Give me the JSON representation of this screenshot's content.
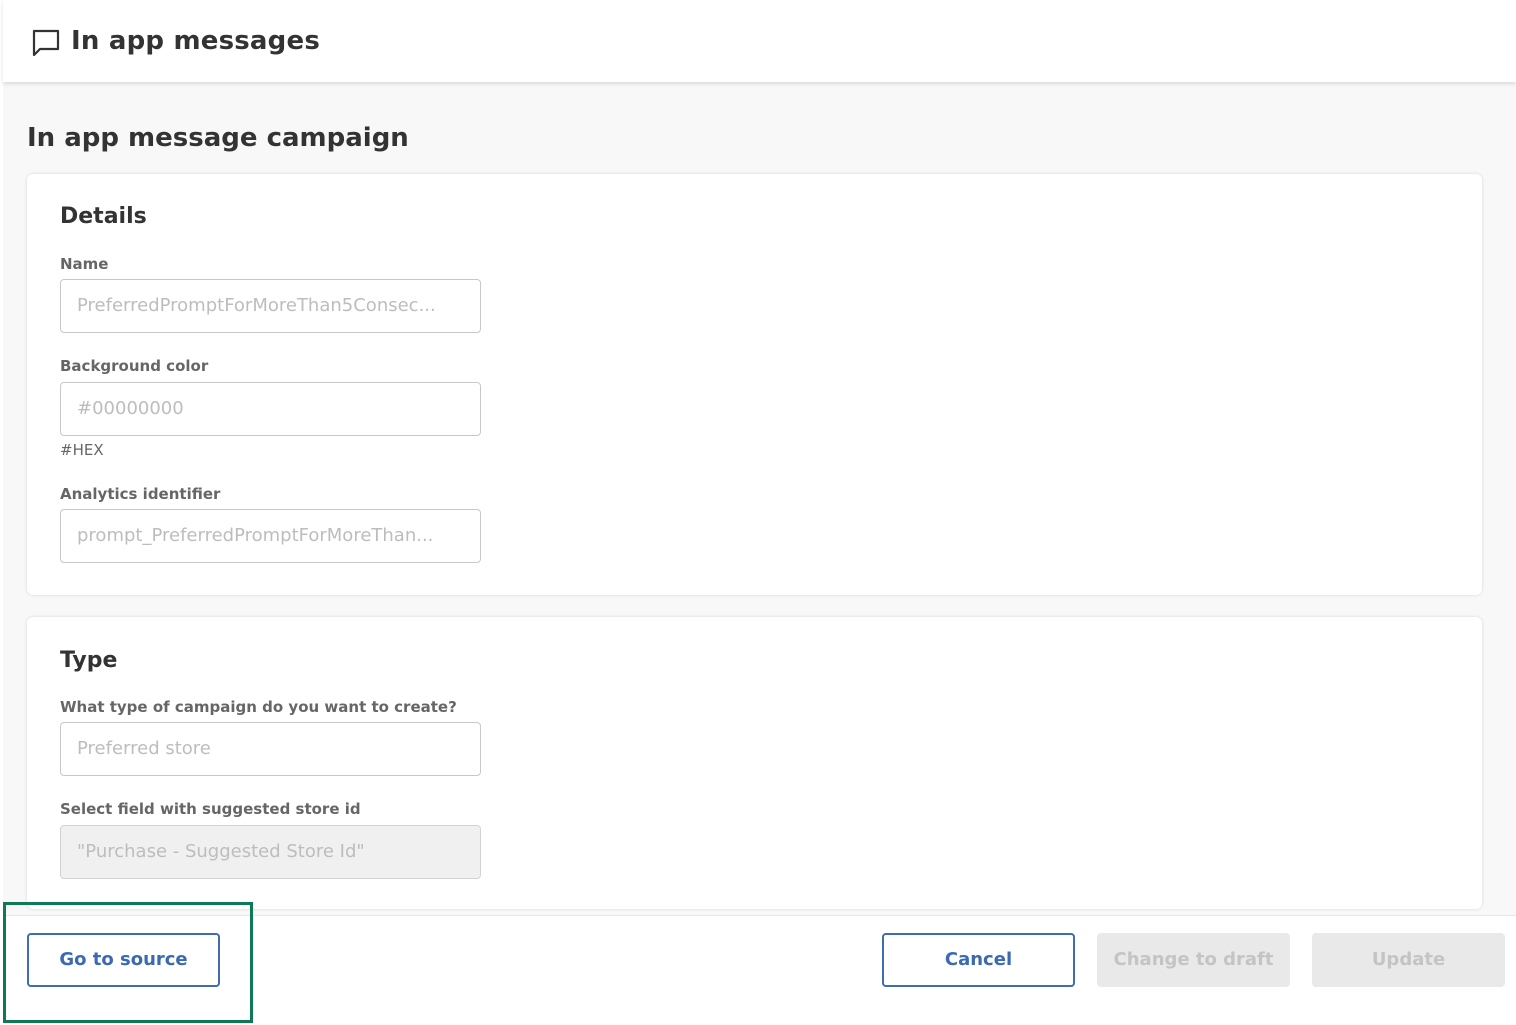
{
  "header": {
    "icon": "chat-bubble-icon",
    "title": "In app messages"
  },
  "page": {
    "title": "In app message campaign"
  },
  "details": {
    "title": "Details",
    "name": {
      "label": "Name",
      "value": "PreferredPromptForMoreThan5Consec..."
    },
    "background_color": {
      "label": "Background color",
      "value": "#00000000",
      "hint": "#HEX"
    },
    "analytics_identifier": {
      "label": "Analytics identifier",
      "value": "prompt_PreferredPromptForMoreThan..."
    }
  },
  "type": {
    "title": "Type",
    "campaign_type": {
      "label": "What type of campaign do you want to create?",
      "value": "Preferred store"
    },
    "store_field": {
      "label": "Select field with suggested store id",
      "value": "\"Purchase - Suggested Store Id\""
    }
  },
  "footer": {
    "go_to_source": "Go to source",
    "cancel": "Cancel",
    "change_to_draft": "Change to draft",
    "update": "Update"
  },
  "colors": {
    "primary": "#3e6cb5",
    "highlight": "#0e7a55",
    "disabled_bg": "#e9e9e9",
    "disabled_text": "#c4c4c4"
  }
}
